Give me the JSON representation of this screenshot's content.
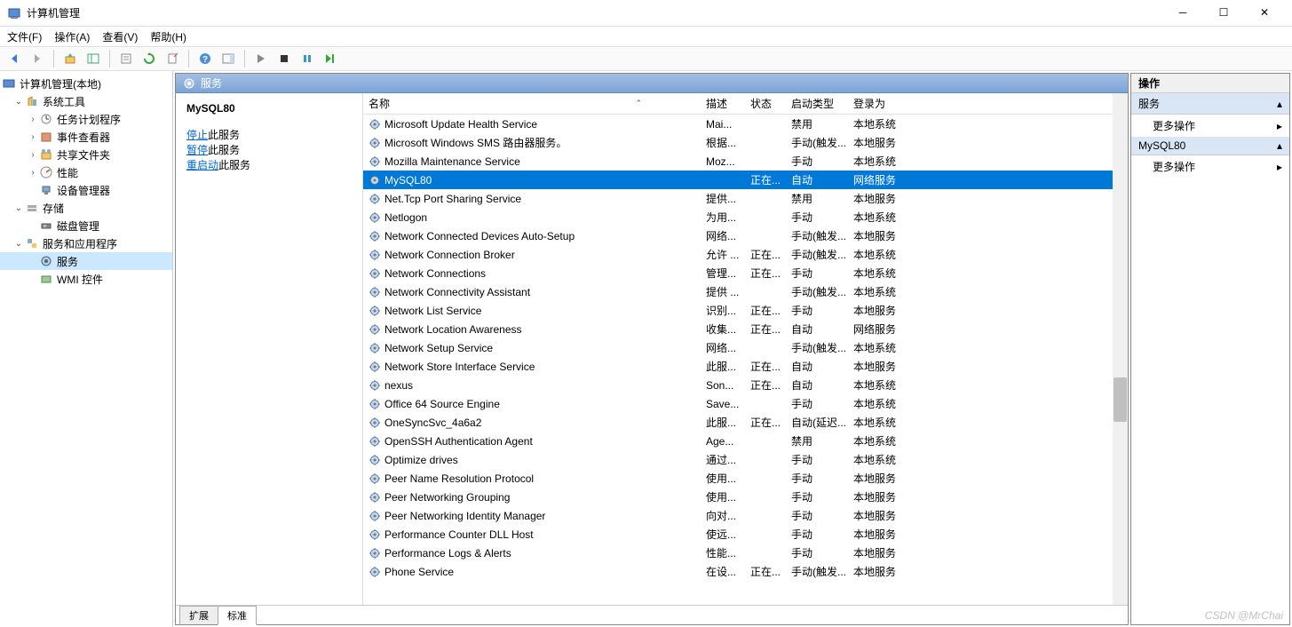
{
  "window": {
    "title": "计算机管理"
  },
  "menu": [
    "文件(F)",
    "操作(A)",
    "查看(V)",
    "帮助(H)"
  ],
  "tree": {
    "root": "计算机管理(本地)",
    "systools": "系统工具",
    "sched": "任务计划程序",
    "event": "事件查看器",
    "shared": "共享文件夹",
    "perf": "性能",
    "devmgr": "设备管理器",
    "storage": "存储",
    "disk": "磁盘管理",
    "apps": "服务和应用程序",
    "services": "服务",
    "wmi": "WMI 控件"
  },
  "center": {
    "head": "服务",
    "selected": "MySQL80",
    "link_stop": "停止",
    "link_pause": "暂停",
    "link_restart": "重启动",
    "suffix": "此服务"
  },
  "columns": {
    "name": "名称",
    "desc": "描述",
    "status": "状态",
    "start": "启动类型",
    "logon": "登录为"
  },
  "services": [
    {
      "name": "Microsoft Update Health Service",
      "desc": "Mai...",
      "status": "",
      "start": "禁用",
      "logon": "本地系统"
    },
    {
      "name": "Microsoft Windows SMS 路由器服务。",
      "desc": "根据...",
      "status": "",
      "start": "手动(触发...",
      "logon": "本地服务"
    },
    {
      "name": "Mozilla Maintenance Service",
      "desc": "Moz...",
      "status": "",
      "start": "手动",
      "logon": "本地系统"
    },
    {
      "name": "MySQL80",
      "desc": "",
      "status": "正在...",
      "start": "自动",
      "logon": "网络服务",
      "sel": true
    },
    {
      "name": "Net.Tcp Port Sharing Service",
      "desc": "提供...",
      "status": "",
      "start": "禁用",
      "logon": "本地服务"
    },
    {
      "name": "Netlogon",
      "desc": "为用...",
      "status": "",
      "start": "手动",
      "logon": "本地系统"
    },
    {
      "name": "Network Connected Devices Auto-Setup",
      "desc": "网络...",
      "status": "",
      "start": "手动(触发...",
      "logon": "本地服务"
    },
    {
      "name": "Network Connection Broker",
      "desc": "允许 ...",
      "status": "正在...",
      "start": "手动(触发...",
      "logon": "本地系统"
    },
    {
      "name": "Network Connections",
      "desc": "管理...",
      "status": "正在...",
      "start": "手动",
      "logon": "本地系统"
    },
    {
      "name": "Network Connectivity Assistant",
      "desc": "提供 ...",
      "status": "",
      "start": "手动(触发...",
      "logon": "本地系统"
    },
    {
      "name": "Network List Service",
      "desc": "识别...",
      "status": "正在...",
      "start": "手动",
      "logon": "本地服务"
    },
    {
      "name": "Network Location Awareness",
      "desc": "收集...",
      "status": "正在...",
      "start": "自动",
      "logon": "网络服务"
    },
    {
      "name": "Network Setup Service",
      "desc": "网络...",
      "status": "",
      "start": "手动(触发...",
      "logon": "本地系统"
    },
    {
      "name": "Network Store Interface Service",
      "desc": "此服...",
      "status": "正在...",
      "start": "自动",
      "logon": "本地服务"
    },
    {
      "name": "nexus",
      "desc": "Son...",
      "status": "正在...",
      "start": "自动",
      "logon": "本地系统"
    },
    {
      "name": "Office 64 Source Engine",
      "desc": "Save...",
      "status": "",
      "start": "手动",
      "logon": "本地系统"
    },
    {
      "name": "OneSyncSvc_4a6a2",
      "desc": "此服...",
      "status": "正在...",
      "start": "自动(延迟...",
      "logon": "本地系统"
    },
    {
      "name": "OpenSSH Authentication Agent",
      "desc": "Age...",
      "status": "",
      "start": "禁用",
      "logon": "本地系统"
    },
    {
      "name": "Optimize drives",
      "desc": "通过...",
      "status": "",
      "start": "手动",
      "logon": "本地系统"
    },
    {
      "name": "Peer Name Resolution Protocol",
      "desc": "使用...",
      "status": "",
      "start": "手动",
      "logon": "本地服务"
    },
    {
      "name": "Peer Networking Grouping",
      "desc": "使用...",
      "status": "",
      "start": "手动",
      "logon": "本地服务"
    },
    {
      "name": "Peer Networking Identity Manager",
      "desc": "向对...",
      "status": "",
      "start": "手动",
      "logon": "本地服务"
    },
    {
      "name": "Performance Counter DLL Host",
      "desc": "使远...",
      "status": "",
      "start": "手动",
      "logon": "本地服务"
    },
    {
      "name": "Performance Logs & Alerts",
      "desc": "性能...",
      "status": "",
      "start": "手动",
      "logon": "本地服务"
    },
    {
      "name": "Phone Service",
      "desc": "在设...",
      "status": "正在...",
      "start": "手动(触发...",
      "logon": "本地服务"
    }
  ],
  "tabs": {
    "ext": "扩展",
    "std": "标准"
  },
  "actions": {
    "head": "操作",
    "sec1": "服务",
    "more": "更多操作",
    "sec2": "MySQL80"
  },
  "watermark": "CSDN @MrChai"
}
